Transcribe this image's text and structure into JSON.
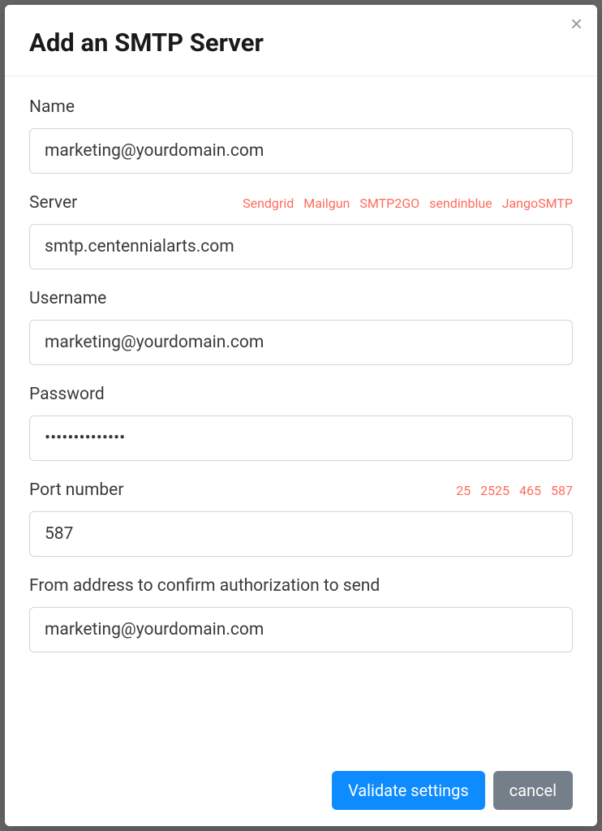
{
  "modal": {
    "title": "Add an SMTP Server",
    "close_symbol": "×"
  },
  "fields": {
    "name": {
      "label": "Name",
      "value": "marketing@yourdomain.com"
    },
    "server": {
      "label": "Server",
      "value": "smtp.centennialarts.com",
      "providers": [
        "Sendgrid",
        "Mailgun",
        "SMTP2GO",
        "sendinblue",
        "JangoSMTP"
      ]
    },
    "username": {
      "label": "Username",
      "value": "marketing@yourdomain.com"
    },
    "password": {
      "label": "Password",
      "value": "••••••••••••••"
    },
    "port": {
      "label": "Port number",
      "value": "587",
      "options": [
        "25",
        "2525",
        "465",
        "587"
      ]
    },
    "from_address": {
      "label": "From address to confirm authorization to send",
      "value": "marketing@yourdomain.com"
    }
  },
  "footer": {
    "validate_label": "Validate settings",
    "cancel_label": "cancel"
  }
}
